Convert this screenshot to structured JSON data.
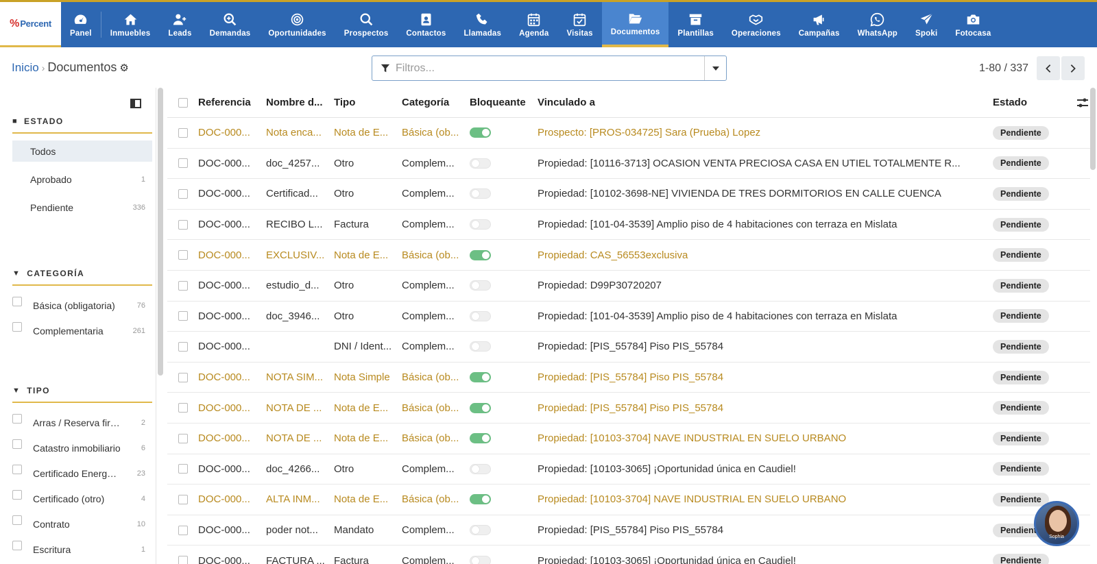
{
  "brand": {
    "logo_text": "Percent",
    "logo_mark": "%"
  },
  "nav": [
    {
      "label": "Panel",
      "icon": "gauge-icon"
    },
    {
      "label": "Inmuebles",
      "icon": "home-icon"
    },
    {
      "label": "Leads",
      "icon": "user-plus-icon"
    },
    {
      "label": "Demandas",
      "icon": "search-plus-icon"
    },
    {
      "label": "Oportunidades",
      "icon": "target-icon"
    },
    {
      "label": "Prospectos",
      "icon": "search-icon"
    },
    {
      "label": "Contactos",
      "icon": "contact-card-icon"
    },
    {
      "label": "Llamadas",
      "icon": "phone-icon"
    },
    {
      "label": "Agenda",
      "icon": "calendar-icon"
    },
    {
      "label": "Visitas",
      "icon": "calendar-check-icon"
    },
    {
      "label": "Documentos",
      "icon": "folder-open-icon",
      "active": true
    },
    {
      "label": "Plantillas",
      "icon": "archive-icon"
    },
    {
      "label": "Operaciones",
      "icon": "handshake-icon"
    },
    {
      "label": "Campañas",
      "icon": "megaphone-icon"
    },
    {
      "label": "WhatsApp",
      "icon": "whatsapp-icon"
    },
    {
      "label": "Spoki",
      "icon": "paper-plane-icon"
    },
    {
      "label": "Fotocasa",
      "icon": "camera-icon"
    }
  ],
  "breadcrumb": {
    "root": "Inicio",
    "current": "Documentos"
  },
  "search": {
    "placeholder": "Filtros...",
    "value": ""
  },
  "pager": {
    "text": "1-80 / 337"
  },
  "sidebar": {
    "estado": {
      "title": "ESTADO",
      "options": [
        {
          "label": "Todos",
          "count": "",
          "selected": true
        },
        {
          "label": "Aprobado",
          "count": "1"
        },
        {
          "label": "Pendiente",
          "count": "336"
        }
      ]
    },
    "categoria": {
      "title": "CATEGORÍA",
      "options": [
        {
          "label": "Básica (obligatoria)",
          "count": "76"
        },
        {
          "label": "Complementaria",
          "count": "261"
        }
      ]
    },
    "tipo": {
      "title": "TIPO",
      "options": [
        {
          "label": "Arras / Reserva fir…",
          "count": "2"
        },
        {
          "label": "Catastro inmobiliario",
          "count": "6"
        },
        {
          "label": "Certificado Energ…",
          "count": "23"
        },
        {
          "label": "Certificado (otro)",
          "count": "4"
        },
        {
          "label": "Contrato",
          "count": "10"
        },
        {
          "label": "Escritura",
          "count": "1"
        }
      ]
    }
  },
  "table": {
    "headers": {
      "ref": "Referencia",
      "name": "Nombre d...",
      "tipo": "Tipo",
      "cat": "Categoría",
      "blo": "Bloqueante",
      "vinc": "Vinculado a",
      "estado": "Estado"
    },
    "rows": [
      {
        "ref": "DOC-000...",
        "name": "Nota enca...",
        "tipo": "Nota de E...",
        "cat": "Básica (ob...",
        "blocking": true,
        "vinc": "Prospecto: [PROS-034725] Sara (Prueba) Lopez",
        "estado": "Pendiente",
        "highlight": true
      },
      {
        "ref": "DOC-000...",
        "name": "doc_4257...",
        "tipo": "Otro",
        "cat": "Complem...",
        "blocking": false,
        "vinc": "Propiedad: [10116-3713] OCASION VENTA PRECIOSA CASA EN UTIEL TOTALMENTE R...",
        "estado": "Pendiente",
        "highlight": false
      },
      {
        "ref": "DOC-000...",
        "name": "Certificad...",
        "tipo": "Otro",
        "cat": "Complem...",
        "blocking": false,
        "vinc": "Propiedad: [10102-3698-NE] VIVIENDA DE TRES DORMITORIOS EN CALLE CUENCA",
        "estado": "Pendiente",
        "highlight": false
      },
      {
        "ref": "DOC-000...",
        "name": "RECIBO L...",
        "tipo": "Factura",
        "cat": "Complem...",
        "blocking": false,
        "vinc": "Propiedad: [101-04-3539] Amplio piso de 4 habitaciones con terraza en Mislata",
        "estado": "Pendiente",
        "highlight": false
      },
      {
        "ref": "DOC-000...",
        "name": "EXCLUSIV...",
        "tipo": "Nota de E...",
        "cat": "Básica (ob...",
        "blocking": true,
        "vinc": "Propiedad: CAS_56553exclusiva",
        "estado": "Pendiente",
        "highlight": true
      },
      {
        "ref": "DOC-000...",
        "name": "estudio_d...",
        "tipo": "Otro",
        "cat": "Complem...",
        "blocking": false,
        "vinc": "Propiedad: D99P30720207",
        "estado": "Pendiente",
        "highlight": false
      },
      {
        "ref": "DOC-000...",
        "name": "doc_3946...",
        "tipo": "Otro",
        "cat": "Complem...",
        "blocking": false,
        "vinc": "Propiedad: [101-04-3539] Amplio piso de 4 habitaciones con terraza en Mislata",
        "estado": "Pendiente",
        "highlight": false
      },
      {
        "ref": "DOC-000...",
        "name": "",
        "tipo": "DNI / Ident...",
        "cat": "Complem...",
        "blocking": false,
        "vinc": "Propiedad: [PIS_55784] Piso PIS_55784",
        "estado": "Pendiente",
        "highlight": false
      },
      {
        "ref": "DOC-000...",
        "name": "NOTA SIM...",
        "tipo": "Nota Simple",
        "cat": "Básica (ob...",
        "blocking": true,
        "vinc": "Propiedad: [PIS_55784] Piso PIS_55784",
        "estado": "Pendiente",
        "highlight": true
      },
      {
        "ref": "DOC-000...",
        "name": "NOTA DE ...",
        "tipo": "Nota de E...",
        "cat": "Básica (ob...",
        "blocking": true,
        "vinc": "Propiedad: [PIS_55784] Piso PIS_55784",
        "estado": "Pendiente",
        "highlight": true
      },
      {
        "ref": "DOC-000...",
        "name": "NOTA DE ...",
        "tipo": "Nota de E...",
        "cat": "Básica (ob...",
        "blocking": true,
        "vinc": "Propiedad: [10103-3704] NAVE INDUSTRIAL EN SUELO URBANO",
        "estado": "Pendiente",
        "highlight": true
      },
      {
        "ref": "DOC-000...",
        "name": "doc_4266...",
        "tipo": "Otro",
        "cat": "Complem...",
        "blocking": false,
        "vinc": "Propiedad: [10103-3065] ¡Oportunidad única en Caudiel!",
        "estado": "Pendiente",
        "highlight": false
      },
      {
        "ref": "DOC-000...",
        "name": "ALTA INM...",
        "tipo": "Nota de E...",
        "cat": "Básica (ob...",
        "blocking": true,
        "vinc": "Propiedad: [10103-3704] NAVE INDUSTRIAL EN SUELO URBANO",
        "estado": "Pendiente",
        "highlight": true
      },
      {
        "ref": "DOC-000...",
        "name": "poder not...",
        "tipo": "Mandato",
        "cat": "Complem...",
        "blocking": false,
        "vinc": "Propiedad: [PIS_55784] Piso PIS_55784",
        "estado": "Pendiente",
        "highlight": false
      },
      {
        "ref": "DOC-000...",
        "name": "FACTURA ...",
        "tipo": "Factura",
        "cat": "Complem...",
        "blocking": false,
        "vinc": "Propiedad: [10103-3065] ¡Oportunidad única en Caudiel!",
        "estado": "Pendiente",
        "highlight": false
      }
    ]
  },
  "assistant": {
    "label": "Sophia"
  },
  "colors": {
    "nav_bg": "#2d67b2",
    "nav_active": "#4a85cf",
    "accent_gold": "#e0b84a",
    "highlight_text": "#b88a1f",
    "toggle_on": "#6cbf84"
  }
}
